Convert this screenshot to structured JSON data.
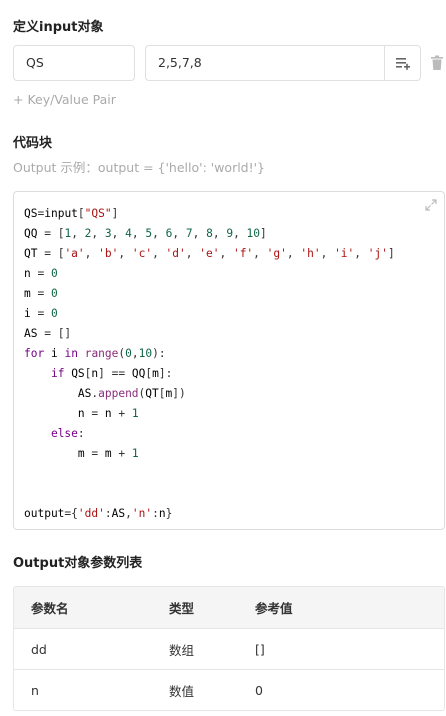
{
  "input_section": {
    "title": "定义input对象",
    "pair": {
      "key": "QS",
      "value": "2,5,7,8"
    },
    "add_pair_label": "+ Key/Value Pair"
  },
  "code_section": {
    "title": "代码块",
    "hint": "Output 示例：output = {'hello': 'world!'}"
  },
  "code_lines": [
    "QS=input[\"QS\"]",
    "QQ = [1, 2, 3, 4, 5, 6, 7, 8, 9, 10]",
    "QT = ['a', 'b', 'c', 'd', 'e', 'f', 'g', 'h', 'i', 'j']",
    "n = 0",
    "m = 0",
    "i = 0",
    "AS = []",
    "for i in range(0,10):",
    "    if QS[n] == QQ[m]:",
    "        AS.append(QT[m])",
    "        n = n + 1",
    "    else:",
    "        m = m + 1",
    "",
    "",
    "output={'dd':AS,'n':n}"
  ],
  "output_section": {
    "title": "Output对象参数列表",
    "headers": [
      "参数名",
      "类型",
      "参考值"
    ],
    "rows": [
      [
        "dd",
        "数组",
        "[]"
      ],
      [
        "n",
        "数值",
        "0"
      ]
    ]
  }
}
